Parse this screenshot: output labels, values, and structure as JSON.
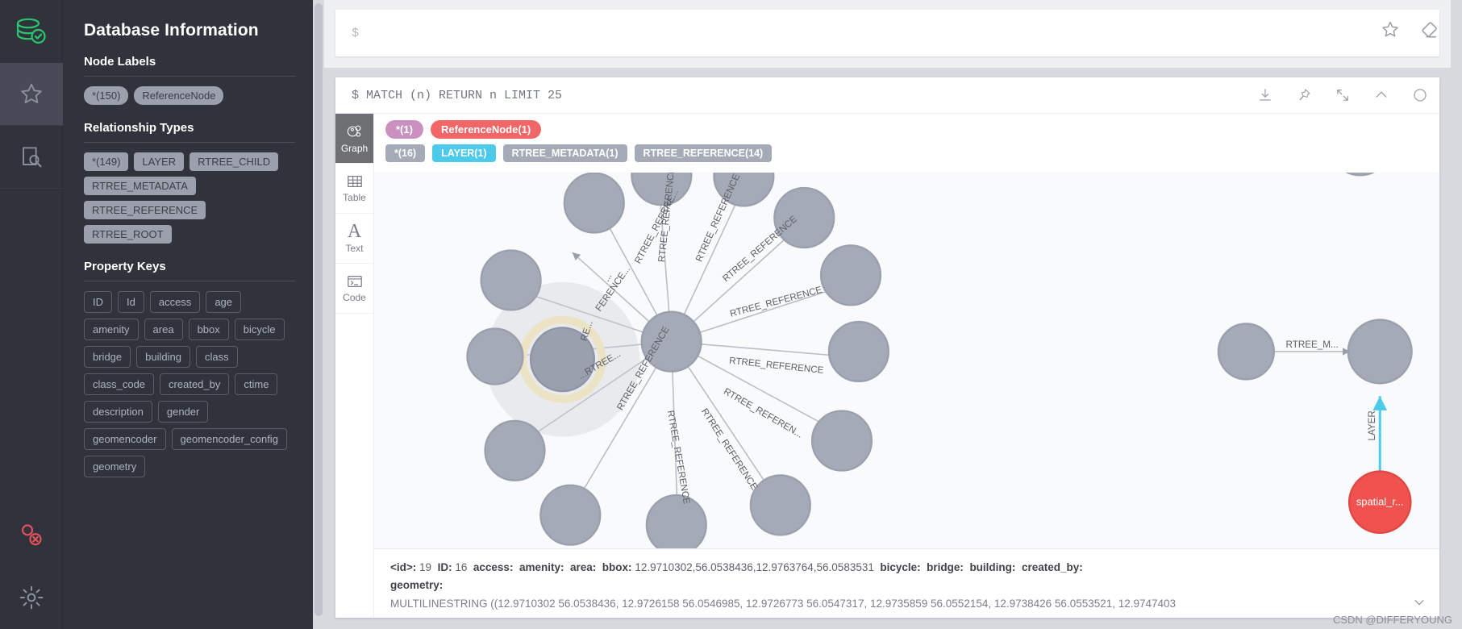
{
  "rail": {
    "logo_icon": "database-check-icon",
    "items": [
      {
        "name": "favorites",
        "icon": "star-icon",
        "selected": false
      },
      {
        "name": "documents",
        "icon": "document-search-icon",
        "selected": false
      }
    ],
    "bottom": [
      {
        "name": "disconnect",
        "icon": "connection-error-icon"
      },
      {
        "name": "settings",
        "icon": "gear-icon"
      }
    ]
  },
  "drawer": {
    "title": "Database Information",
    "sections": [
      {
        "heading": "Node Labels",
        "style": "pill",
        "chips": [
          "*(150)",
          "ReferenceNode"
        ]
      },
      {
        "heading": "Relationship Types",
        "style": "square",
        "chips": [
          "*(149)",
          "LAYER",
          "RTREE_CHILD",
          "RTREE_METADATA",
          "RTREE_REFERENCE",
          "RTREE_ROOT"
        ]
      },
      {
        "heading": "Property Keys",
        "style": "outline",
        "chips": [
          "ID",
          "Id",
          "access",
          "age",
          "amenity",
          "area",
          "bbox",
          "bicycle",
          "bridge",
          "building",
          "class",
          "class_code",
          "created_by",
          "ctime",
          "description",
          "gender",
          "geomencoder",
          "geomencoder_config",
          "geometry"
        ]
      }
    ]
  },
  "editor": {
    "placeholder": "$",
    "value": "",
    "icons": [
      "star-outline-icon",
      "eraser-icon"
    ]
  },
  "frame": {
    "query": "$ MATCH (n) RETURN n LIMIT 25",
    "tools": [
      "download-icon",
      "pin-icon",
      "expand-icon",
      "collapse-icon",
      "close-icon"
    ],
    "view_tabs": [
      {
        "label": "Graph",
        "icon": "graph-icon",
        "active": true
      },
      {
        "label": "Table",
        "icon": "table-icon",
        "active": false
      },
      {
        "label": "Text",
        "icon": "text-a-icon",
        "active": false
      },
      {
        "label": "Code",
        "icon": "code-terminal-icon",
        "active": false
      }
    ],
    "legend": {
      "nodes": [
        {
          "label": "*(1)",
          "color": "#c990c0"
        },
        {
          "label": "ReferenceNode(1)",
          "color": "#f16667"
        }
      ],
      "relationships": [
        {
          "label": "*(16)",
          "color": "#a5abb6"
        },
        {
          "label": "LAYER(1)",
          "color": "#4ccaea"
        },
        {
          "label": "RTREE_METADATA(1)",
          "color": "#a5abb6"
        },
        {
          "label": "RTREE_REFERENCE(14)",
          "color": "#a5abb6"
        }
      ]
    }
  },
  "graph": {
    "relationship_label": "RTREE_REFERENCE",
    "right_labels": {
      "rtree_metadata": "RTREE_M...",
      "layer": "LAYER",
      "spatial_node": "spatial_r..."
    }
  },
  "inspector": {
    "fields": [
      {
        "key": "<id>:",
        "value": "19"
      },
      {
        "key": "ID:",
        "value": "16"
      },
      {
        "key": "access:",
        "value": ""
      },
      {
        "key": "amenity:",
        "value": ""
      },
      {
        "key": "area:",
        "value": ""
      },
      {
        "key": "bbox:",
        "value": "12.9710302,56.0538436,12.9763764,56.0583531"
      },
      {
        "key": "bicycle:",
        "value": ""
      },
      {
        "key": "bridge:",
        "value": ""
      },
      {
        "key": "building:",
        "value": ""
      },
      {
        "key": "created_by:",
        "value": ""
      }
    ],
    "geometry_key": "geometry:",
    "geometry_value": "MULTILINESTRING ((12.9710302 56.0538436, 12.9726158 56.0546985, 12.9726773 56.0547317, 12.9735859 56.0552154, 12.9738426 56.0553521, 12.9747403"
  },
  "watermark": "CSDN @DIFFERYOUNG"
}
